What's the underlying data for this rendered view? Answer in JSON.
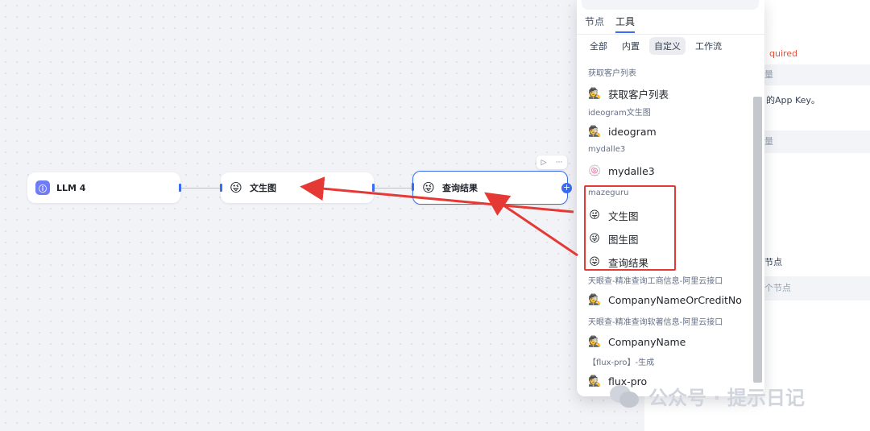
{
  "canvas": {
    "nodes": [
      {
        "label": "LLM 4",
        "icon": "llm-icon"
      },
      {
        "label": "文生图",
        "icon": "smiley-face-icon"
      },
      {
        "label": "查询结果",
        "icon": "smiley-face-icon"
      }
    ],
    "toolbar": {
      "run_icon": "▷",
      "more_icon": "···"
    },
    "add_symbol": "+"
  },
  "popup": {
    "tabs": [
      "节点",
      "工具"
    ],
    "active_tab": "工具",
    "filters": [
      "全部",
      "内置",
      "自定义",
      "工作流"
    ],
    "active_filter": "自定义",
    "groups": [
      {
        "name": "获取客户列表",
        "items": [
          "获取客户列表"
        ]
      },
      {
        "name": "ideogram文生图",
        "items": [
          "ideogram"
        ]
      },
      {
        "name": "mydalle3",
        "items": [
          "mydalle3"
        ]
      },
      {
        "name": "mazeguru",
        "items": [
          "文生图",
          "图生图",
          "查询结果"
        ]
      },
      {
        "name": "天眼查-精准查询工商信息-阿里云接口",
        "items": [
          "CompanyNameOrCreditNo"
        ]
      },
      {
        "name": "天眼查-精准查询软著信息-阿里云接口",
        "items": [
          "CompanyName"
        ]
      },
      {
        "name": "【flux-pro】-生成",
        "items": [
          "flux-pro"
        ]
      }
    ]
  },
  "side_panel": {
    "required_text": "quired",
    "var_label_1": "量",
    "desc_text": "的App Key。",
    "var_label_2": "量",
    "node_text": "节点",
    "node_text_2": "个节点"
  },
  "watermark": "公众号 · 提示日记",
  "colors": {
    "accent": "#3b6df0",
    "annotation_red": "#e53935",
    "required_red": "#e5533d"
  }
}
